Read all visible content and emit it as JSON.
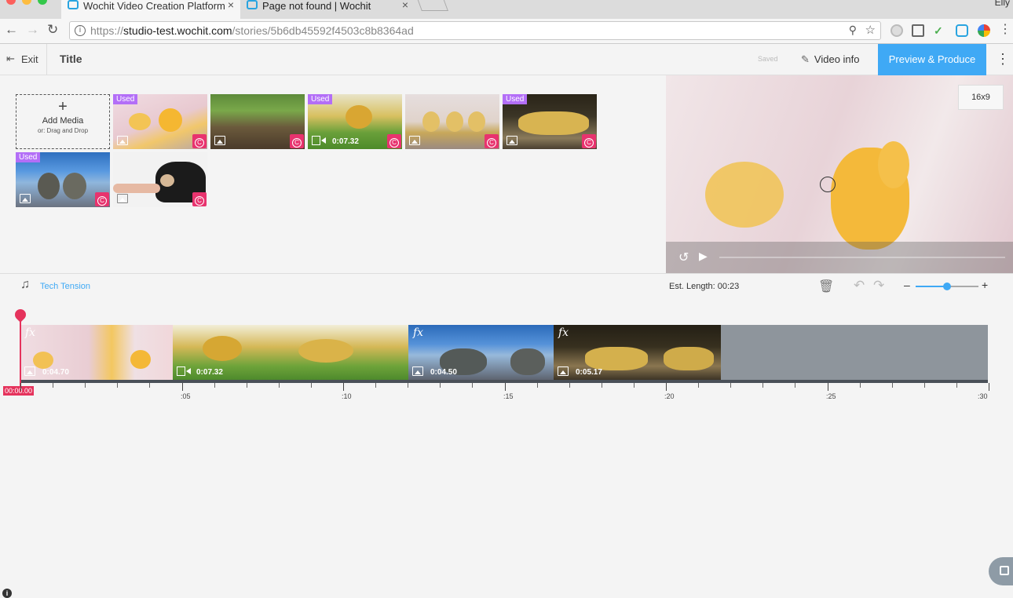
{
  "browser": {
    "tabs": [
      {
        "title": "Wochit Video Creation Platform"
      },
      {
        "title": "Page not found | Wochit"
      }
    ],
    "profile_name": "Elly",
    "url_scheme": "https://",
    "url_host": "studio-test.wochit.com",
    "url_path": "/stories/5b6db45592f4503c8b8364ad"
  },
  "header": {
    "exit_label": "Exit",
    "title": "Title",
    "saved_label": "Saved",
    "video_info_label": "Video info",
    "produce_label": "Preview & Produce"
  },
  "media": {
    "add_media_label": "Add Media",
    "add_media_hint": "or: Drag and Drop",
    "used_label": "Used",
    "items": [
      {
        "kind": "image",
        "used": true
      },
      {
        "kind": "image",
        "used": false
      },
      {
        "kind": "video",
        "used": true,
        "duration": "0:07.32"
      },
      {
        "kind": "image",
        "used": false
      },
      {
        "kind": "image",
        "used": true
      },
      {
        "kind": "image",
        "used": true
      },
      {
        "kind": "image",
        "used": false
      }
    ]
  },
  "preview": {
    "aspect_label": "16x9"
  },
  "audio": {
    "track_name": "Tech Tension",
    "est_length_label": "Est. Length: 00:23"
  },
  "timeline": {
    "playhead_time": "00:00.00",
    "clips": [
      {
        "kind": "image",
        "duration": "0:04.70",
        "fx": true
      },
      {
        "kind": "video",
        "duration": "0:07.32",
        "fx": false
      },
      {
        "kind": "image",
        "duration": "0:04.50",
        "fx": true
      },
      {
        "kind": "image",
        "duration": "0:05.17",
        "fx": true
      }
    ],
    "ruler_labels": [
      ":05",
      ":10",
      ":15",
      ":20",
      ":25",
      ":30"
    ],
    "zoom_level": 0.5
  },
  "colors": {
    "accent": "#3fa9f5",
    "used_badge": "#b36ef7",
    "copyright_badge": "#e8336e",
    "playhead": "#e5335c"
  }
}
